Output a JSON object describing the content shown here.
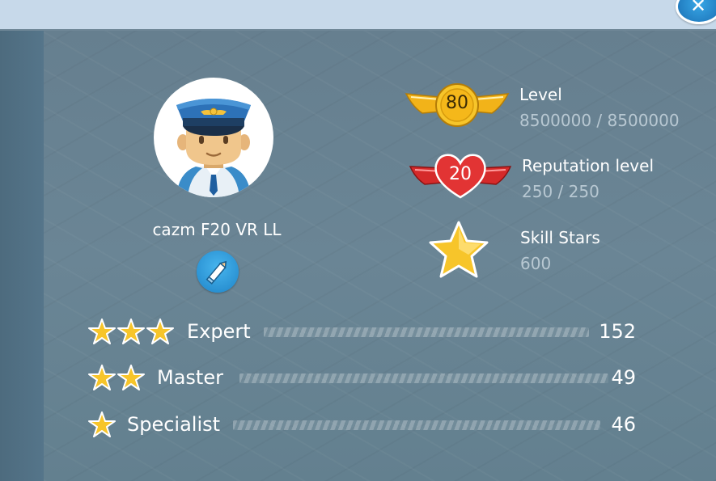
{
  "window": {
    "close_icon": "close-icon"
  },
  "profile": {
    "username": "cazm F20 VR LL",
    "avatar_icon": "pilot-avatar-icon",
    "edit_icon": "pencil-icon"
  },
  "stats": [
    {
      "badge_icon": "winged-gold-medal-icon",
      "badge_value": "80",
      "label": "Level",
      "value": "8500000 / 8500000"
    },
    {
      "badge_icon": "winged-heart-icon",
      "badge_value": "20",
      "label": "Reputation level",
      "value": "250 / 250"
    },
    {
      "badge_icon": "gold-star-icon",
      "badge_value": "",
      "label": "Skill Stars",
      "value": "600"
    }
  ],
  "ranks": [
    {
      "stars": 3,
      "label": "Expert",
      "count": "152"
    },
    {
      "stars": 2,
      "label": "Master",
      "count": "49"
    },
    {
      "stars": 1,
      "label": "Specialist",
      "count": "46"
    }
  ],
  "colors": {
    "panel_bg": "#667f8f",
    "topbar_bg": "#c7d9ea",
    "gold": "#f2b319",
    "red": "#d52a2a",
    "button_blue": "#1f84c8",
    "secondary_text": "#b8c8d2"
  }
}
